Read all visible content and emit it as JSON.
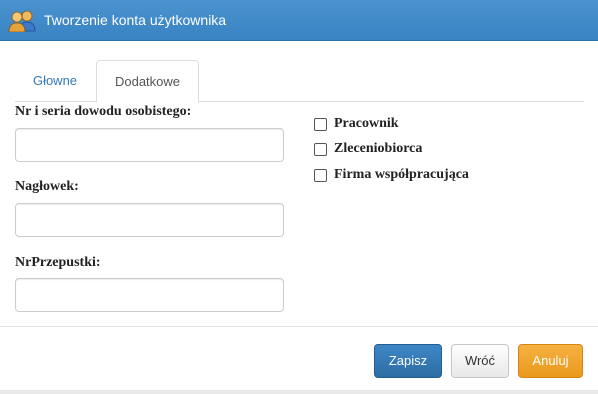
{
  "window": {
    "title": "Tworzenie konta użytkownika",
    "icon": "users-icon"
  },
  "tabs": [
    {
      "label": "Głowne",
      "active": false
    },
    {
      "label": "Dodatkowe",
      "active": true
    }
  ],
  "form": {
    "id_number": {
      "label": "Nr i seria dowodu osobistego:",
      "value": ""
    },
    "heading": {
      "label": "Nagłowek:",
      "value": ""
    },
    "pass_number": {
      "label": "NrPrzepustki:",
      "value": ""
    }
  },
  "checkboxes": [
    {
      "label": "Pracownik",
      "checked": false
    },
    {
      "label": "Zleceniobiorca",
      "checked": false
    },
    {
      "label": "Firma współpracująca",
      "checked": false
    }
  ],
  "buttons": {
    "save": "Zapisz",
    "back": "Wróć",
    "cancel": "Anuluj"
  },
  "colors": {
    "title_bar": "#3a83c3",
    "save_button": "#2d6da3",
    "cancel_button": "#ea9a1c",
    "tab_link": "#337ab7"
  }
}
